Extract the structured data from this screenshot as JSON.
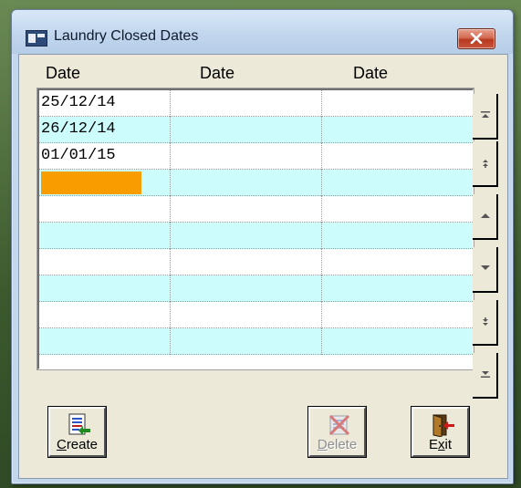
{
  "window": {
    "title": "Laundry Closed Dates"
  },
  "grid": {
    "columns": [
      "Date",
      "Date",
      "Date"
    ],
    "rows": [
      [
        "25/12/14",
        "",
        ""
      ],
      [
        "26/12/14",
        "",
        ""
      ],
      [
        "01/01/15",
        "",
        ""
      ],
      [
        "",
        "",
        ""
      ],
      [
        "",
        "",
        ""
      ],
      [
        "",
        "",
        ""
      ],
      [
        "",
        "",
        ""
      ],
      [
        "",
        "",
        ""
      ],
      [
        "",
        "",
        ""
      ],
      [
        "",
        "",
        ""
      ]
    ],
    "row_colors": {
      "normal": "#ffffff",
      "alternate": "#ccfcfc",
      "active_cell": "#f89d00"
    }
  },
  "scrollbar": {
    "buttons": [
      "scroll-top-icon",
      "page-up-icon",
      "line-up-icon",
      "line-down-icon",
      "page-down-icon",
      "scroll-bottom-icon"
    ]
  },
  "buttons": {
    "create": {
      "label_underlined": "C",
      "label_rest": "reate",
      "icon": "create-list-icon"
    },
    "delete": {
      "label_underlined": "D",
      "label_rest": "elete",
      "icon": "delete-x-icon",
      "disabled": true
    },
    "exit": {
      "label_pre": "E",
      "label_underlined": "x",
      "label_rest": "it",
      "icon": "exit-door-icon"
    }
  }
}
